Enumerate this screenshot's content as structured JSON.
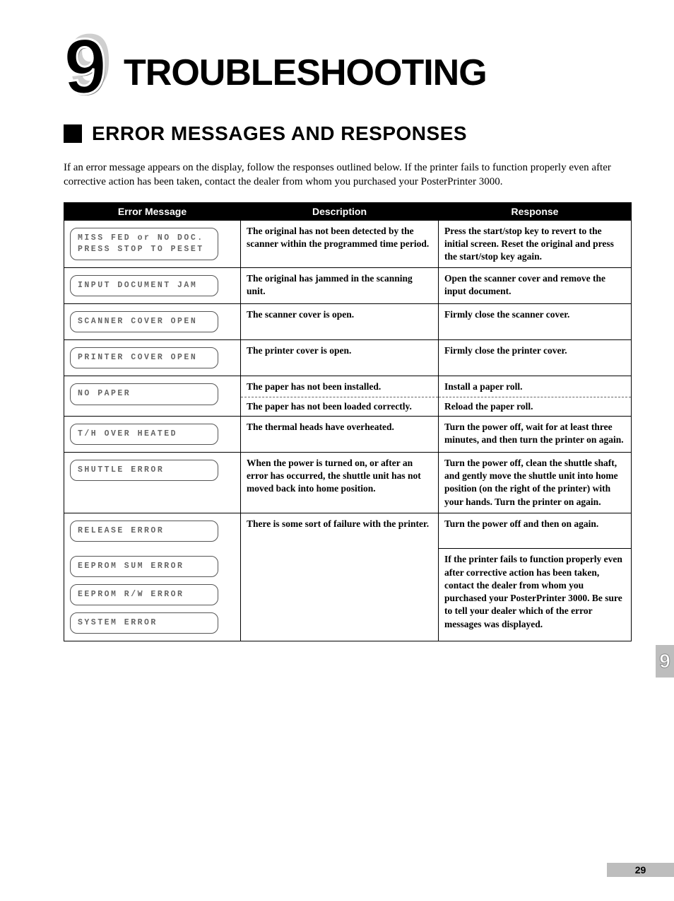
{
  "chapter": {
    "number": "9",
    "title": "TROUBLESHOOTING"
  },
  "section": {
    "title": "ERROR MESSAGES AND RESPONSES"
  },
  "intro": "If an error message appears on the display, follow the responses outlined below.  If the printer fails to function properly even after corrective action has been taken, contact the dealer from whom you purchased your PosterPrinter 3000.",
  "headers": {
    "message": "Error Message",
    "description": "Description",
    "response": "Response"
  },
  "rows": {
    "r1": {
      "msg_line1": "MISS FED or NO DOC.",
      "msg_line2": "PRESS STOP TO PESET",
      "desc": "The original has not been detected by the scanner within the programmed time period.",
      "resp": "Press the start/stop key to revert to the initial screen.  Reset the original and press the start/stop key again."
    },
    "r2": {
      "msg": "INPUT DOCUMENT JAM",
      "desc": "The original has jammed in the scanning unit.",
      "resp": "Open the scanner cover and remove the input document."
    },
    "r3": {
      "msg": "SCANNER COVER OPEN",
      "desc": "The scanner cover is open.",
      "resp": "Firmly close the scanner cover."
    },
    "r4": {
      "msg": "PRINTER COVER OPEN",
      "desc": "The printer cover is open.",
      "resp": "Firmly close the printer cover."
    },
    "r5": {
      "msg": "NO PAPER",
      "desc1": "The paper has not been installed.",
      "resp1": "Install a paper roll.",
      "desc2": "The paper has not been loaded correctly.",
      "resp2": "Reload the paper roll."
    },
    "r6": {
      "msg": "T/H OVER HEATED",
      "desc": "The thermal heads have overheated.",
      "resp": "Turn the power off, wait for at least three minutes, and then turn the printer on again."
    },
    "r7": {
      "msg": "SHUTTLE ERROR",
      "desc": "When the power is turned on, or after an error has occurred,  the shuttle unit has not moved back into home position.",
      "resp": "Turn the power off, clean the shuttle shaft, and gently move the shuttle unit into home position (on the right of the printer) with your hands. Turn the printer on again."
    },
    "r8": {
      "msg1": "RELEASE ERROR",
      "msg2": "EEPROM SUM ERROR",
      "msg3": "EEPROM R/W ERROR",
      "msg4": "SYSTEM ERROR",
      "desc": "There is some sort of failure with the printer.",
      "resp1": "Turn the power off and then on again.",
      "resp2": "If the printer fails to function properly even after corrective action has been taken, contact the dealer from whom you purchased your PosterPrinter 3000. Be sure to tell your dealer which of the error messages was displayed."
    }
  },
  "sidetab": "9",
  "pagenum": "29"
}
